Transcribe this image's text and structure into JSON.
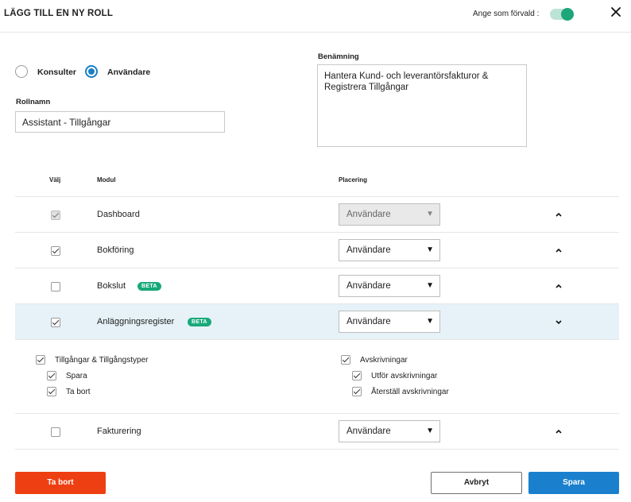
{
  "header": {
    "title": "LÄGG TILL EN NY ROLL",
    "default_label": "Ange som förvald :",
    "default_on": true
  },
  "role_type": {
    "options": [
      "Konsulter",
      "Användare"
    ],
    "selected": "Användare"
  },
  "role_name": {
    "label": "Rollnamn",
    "value": "Assistant - Tillgångar"
  },
  "description": {
    "label": "Benämning",
    "value": "Hantera Kund- och leverantörsfakturor & Registrera Tillgångar"
  },
  "table": {
    "columns": {
      "select": "Välj",
      "module": "Modul",
      "placement": "Placering"
    },
    "rows": [
      {
        "module": "Dashboard",
        "checked": true,
        "disabled": true,
        "beta": false,
        "placement": "Användare",
        "expanded": false
      },
      {
        "module": "Bokföring",
        "checked": true,
        "disabled": false,
        "beta": false,
        "placement": "Användare",
        "expanded": false
      },
      {
        "module": "Bokslut",
        "checked": false,
        "disabled": false,
        "beta": true,
        "beta_label": "BETA",
        "placement": "Användare",
        "expanded": false
      },
      {
        "module": "Anläggningsregister",
        "checked": true,
        "disabled": false,
        "beta": true,
        "beta_label": "BETA",
        "placement": "Användare",
        "expanded": true
      },
      {
        "module": "Fakturering",
        "checked": false,
        "disabled": false,
        "beta": false,
        "placement": "Användare",
        "expanded": false
      }
    ],
    "sub_permissions": {
      "left": {
        "label": "Tillgångar & Tillgångstyper",
        "checked": true,
        "children": [
          {
            "label": "Spara",
            "checked": true
          },
          {
            "label": "Ta bort",
            "checked": true
          }
        ]
      },
      "right": {
        "label": "Avskrivningar",
        "checked": true,
        "children": [
          {
            "label": "Utför avskrivningar",
            "checked": true
          },
          {
            "label": "Återställ avskrivningar",
            "checked": true
          }
        ]
      }
    }
  },
  "footer": {
    "delete_label": "Ta bort",
    "cancel_label": "Avbryt",
    "save_label": "Spara"
  },
  "colors": {
    "accent": "#1a80ce",
    "toggle": "#1ea67a",
    "danger": "#ee3f12",
    "beta": "#18a97a",
    "highlight_row": "#e6f2f8"
  }
}
